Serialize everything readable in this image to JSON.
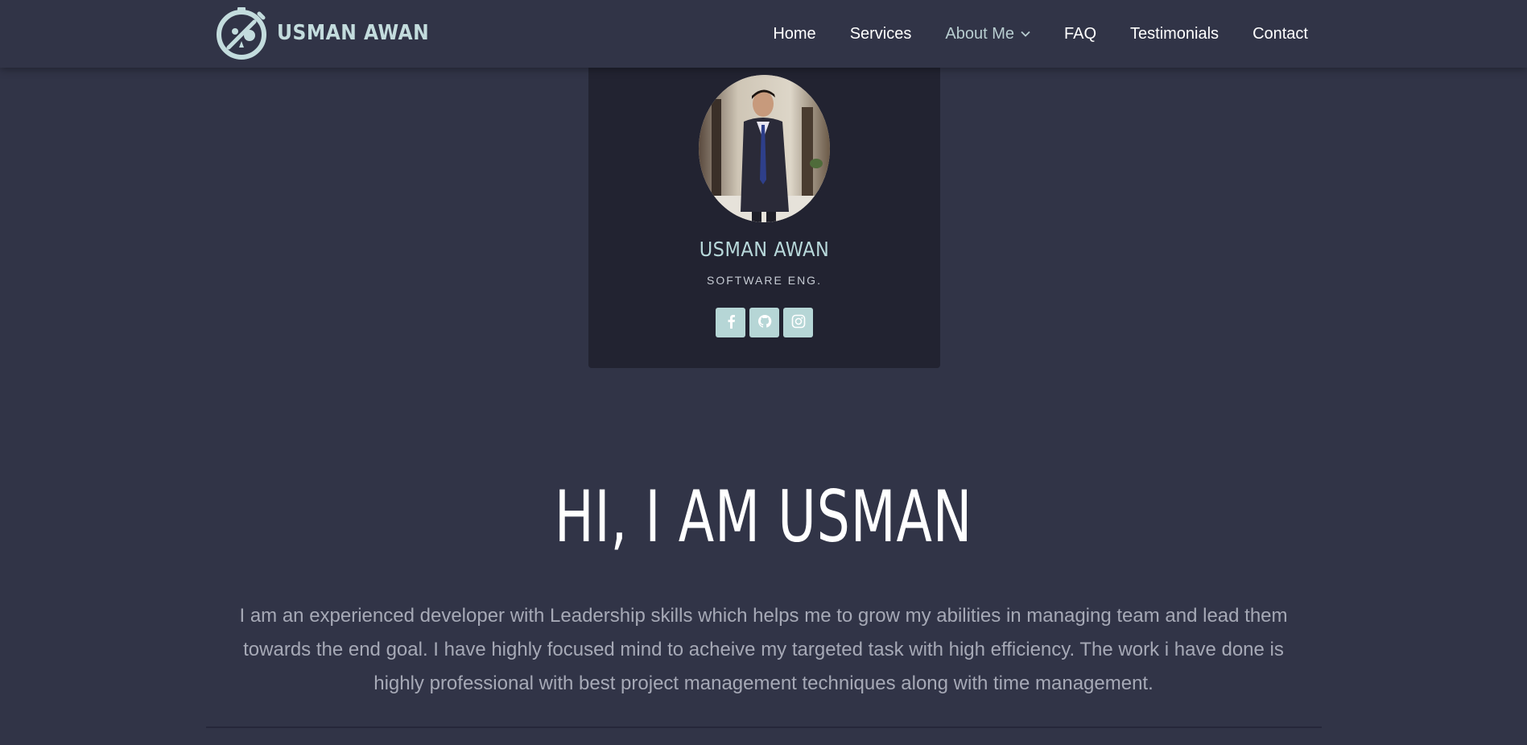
{
  "brand": {
    "logo_text": "USMAN AWAN",
    "logo_icon": "compass-icon",
    "color": "#c3dcdd"
  },
  "nav": {
    "items": [
      {
        "label": "Home",
        "active": false
      },
      {
        "label": "Services",
        "active": false
      },
      {
        "label": "About Me",
        "active": true,
        "has_dropdown": true,
        "dropdown_icon": "chevron-down-icon"
      },
      {
        "label": "FAQ",
        "active": false
      },
      {
        "label": "Testimonials",
        "active": false
      },
      {
        "label": "Contact",
        "active": false
      }
    ]
  },
  "profile": {
    "name": "USMAN AWAN",
    "role": "SOFTWARE ENG.",
    "socials": [
      {
        "icon": "facebook-icon"
      },
      {
        "icon": "github-icon"
      },
      {
        "icon": "instagram-icon"
      }
    ]
  },
  "hero": {
    "title": "HI, I AM USMAN",
    "text": "I am an experienced developer with Leadership skills which helps me to grow my abilities in managing team and lead them towards the end goal. I have highly focused mind to acheive my targeted task with high efficiency. The work i have done is highly professional with best project management techniques along with time management."
  },
  "colors": {
    "background": "#313447",
    "card": "#222331",
    "accent": "#b6d6d6",
    "nav_active": "#b8cdd0"
  }
}
